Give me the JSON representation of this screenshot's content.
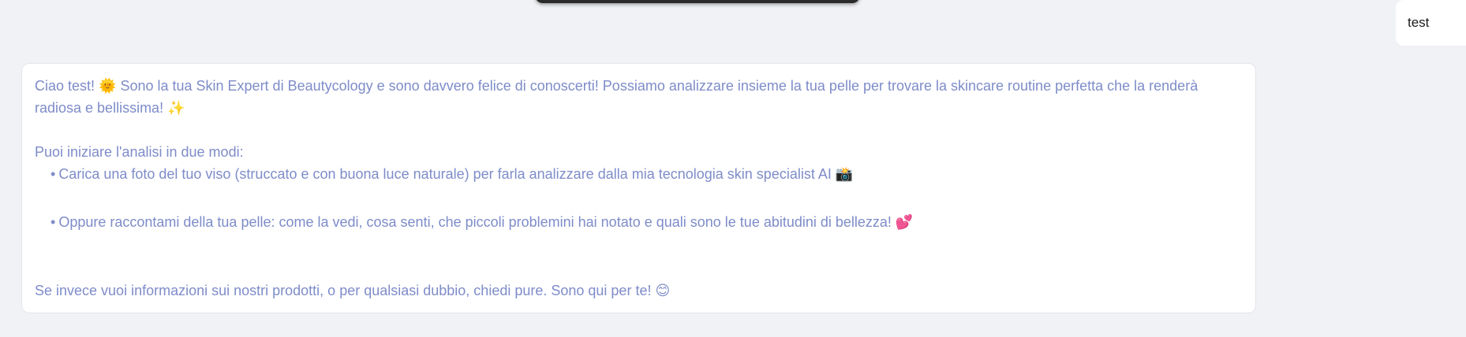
{
  "user_message": {
    "text": "test"
  },
  "bot_message": {
    "greeting": "Ciao test! 🌞 Sono la tua Skin Expert di Beautycology e sono davvero felice di conoscerti! Possiamo analizzare insieme la tua pelle per trovare la skincare routine perfetta che la renderà radiosa e bellissima! ✨",
    "intro": "Puoi iniziare l'analisi in due modi:",
    "bullet_symbol": "•",
    "options": [
      "Carica una foto del tuo viso (struccato e con buona luce naturale) per farla analizzare dalla mia tecnologia skin specialist AI 📸",
      "Oppure raccontami della tua pelle: come la vedi, cosa senti, che piccoli problemini hai notato e quali sono le tue abitudini di bellezza! 💕"
    ],
    "closing": "Se invece vuoi informazioni sui nostri prodotti, o per qualsiasi dubbio, chiedi pure. Sono qui per te! 😊"
  },
  "colors": {
    "background": "#f1f2f5",
    "bubble": "#ffffff",
    "bot_text": "#7e8cc9",
    "user_text": "#1a1a1a",
    "top_bar": "#2b2b2b"
  }
}
